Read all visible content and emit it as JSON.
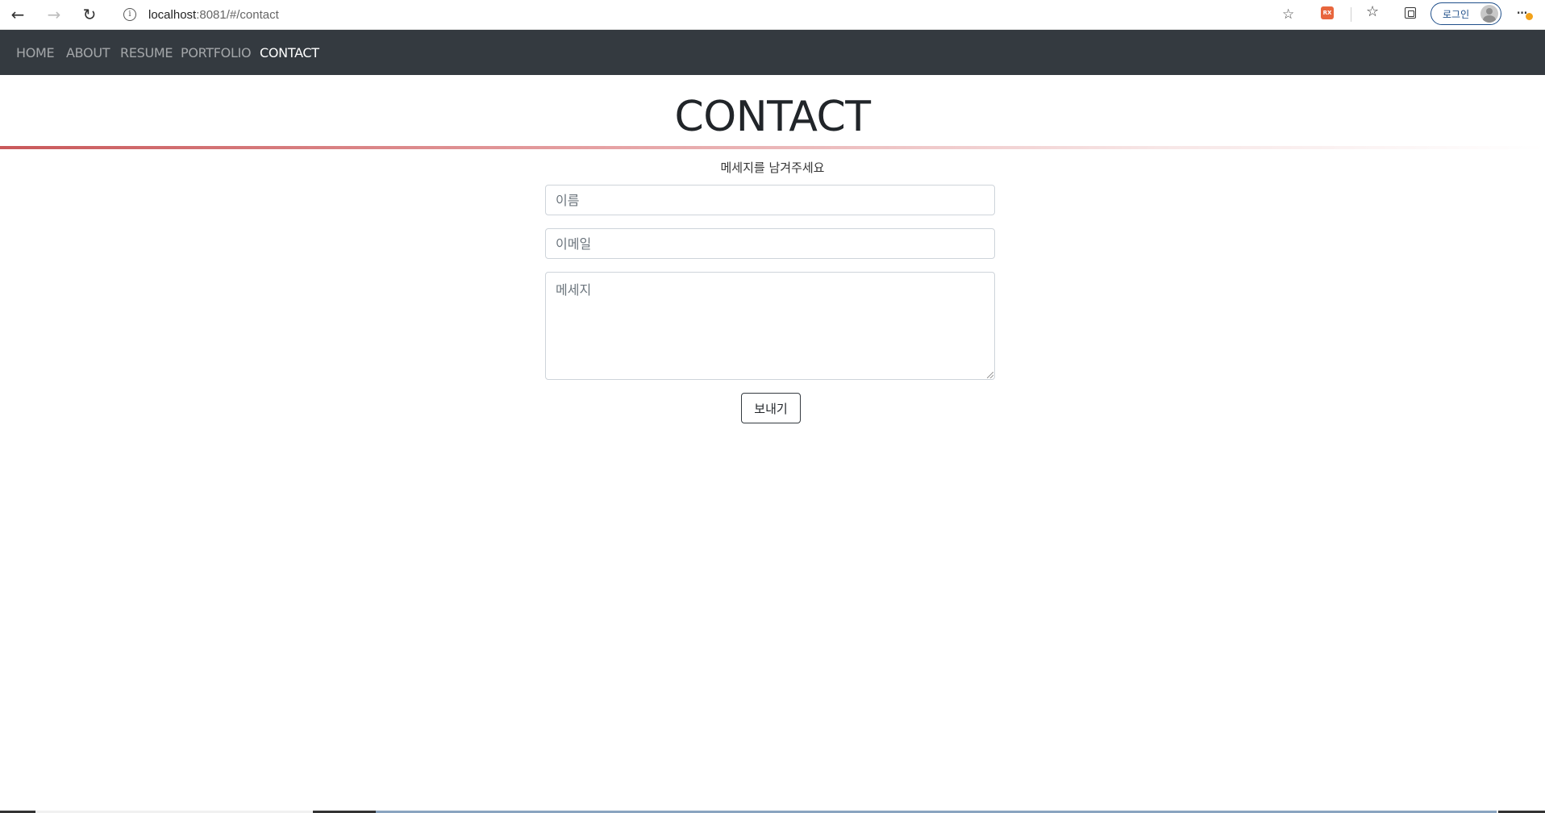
{
  "browser": {
    "url_host": "localhost",
    "url_path": ":8081/#/contact",
    "profile_label": "로그인",
    "extension_label": "RX"
  },
  "nav": {
    "items": [
      {
        "label": "HOME"
      },
      {
        "label": "ABOUT"
      },
      {
        "label": "RESUME"
      },
      {
        "label": "PORTFOLIO"
      },
      {
        "label": "CONTACT",
        "active": true
      }
    ]
  },
  "page": {
    "title": "CONTACT",
    "subtitle": "메세지를 남겨주세요"
  },
  "form": {
    "name_placeholder": "이름",
    "email_placeholder": "이메일",
    "message_placeholder": "메세지",
    "submit_label": "보내기"
  },
  "colors": {
    "navbar_bg": "#343a40",
    "title_rule_start": "#c9585a",
    "text": "#212529"
  }
}
